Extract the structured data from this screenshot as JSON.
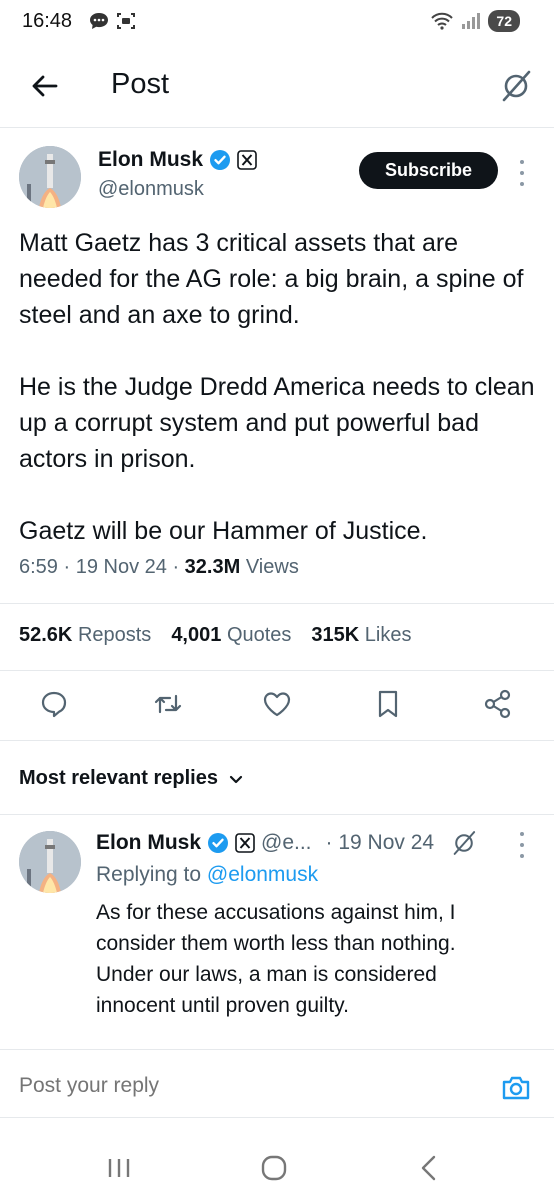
{
  "status_bar": {
    "time": "16:48",
    "battery": "72"
  },
  "header": {
    "title": "Post"
  },
  "post": {
    "author_name": "Elon Musk",
    "author_handle": "@elonmusk",
    "subscribe_label": "Subscribe",
    "paragraphs": [
      "Matt Gaetz has 3 critical assets that are needed for the AG role: a big brain, a spine of steel and an axe to grind.",
      "He is the Judge Dredd America needs to clean up a corrupt system and put powerful bad actors in prison.",
      "Gaetz will be our Hammer of Justice."
    ],
    "time": "6:59",
    "date": "19 Nov 24",
    "views_count": "32.3M",
    "views_label": "Views",
    "reposts_count": "52.6K",
    "reposts_label": "Reposts",
    "quotes_count": "4,001",
    "quotes_label": "Quotes",
    "likes_count": "315K",
    "likes_label": "Likes"
  },
  "replies": {
    "sort_label": "Most relevant replies",
    "items": [
      {
        "author_name": "Elon Musk",
        "handle_truncated": "@e...",
        "date": "· 19 Nov 24",
        "replying_prefix": "Replying to",
        "replying_to": "@elonmusk",
        "text": "As for these accusations against him, I consider them worth less than nothing. Under our laws, a man is considered innocent until proven guilty."
      }
    ]
  },
  "compose": {
    "placeholder": "Post your reply"
  },
  "colors": {
    "accent": "#1d9bf0",
    "text": "#0f1419",
    "muted": "#536471",
    "verified": "#1d9bf0"
  }
}
